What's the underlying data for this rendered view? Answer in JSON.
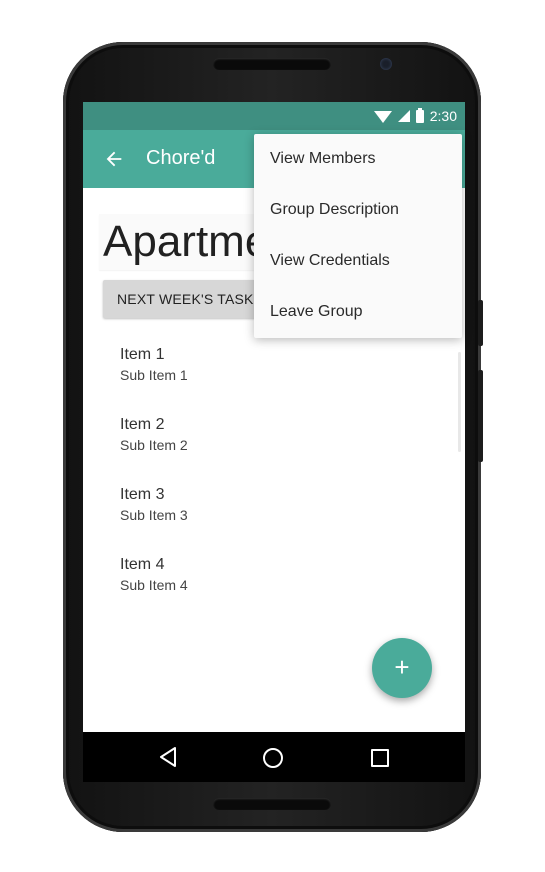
{
  "statusbar": {
    "time": "2:30"
  },
  "appbar": {
    "title": "Chore'd"
  },
  "group": {
    "title": "Apartme"
  },
  "tasks_button": {
    "label": "NEXT WEEK'S TASKS"
  },
  "list": {
    "items": [
      {
        "title": "Item 1",
        "subtitle": "Sub Item 1"
      },
      {
        "title": "Item 2",
        "subtitle": "Sub Item 2"
      },
      {
        "title": "Item 3",
        "subtitle": "Sub Item 3"
      },
      {
        "title": "Item 4",
        "subtitle": "Sub Item 4"
      }
    ]
  },
  "fab": {
    "label": "+"
  },
  "menu": {
    "items": [
      {
        "label": "View Members"
      },
      {
        "label": "Group Description"
      },
      {
        "label": "View Credentials"
      },
      {
        "label": "Leave Group"
      }
    ]
  },
  "colors": {
    "primary": "#4aab9a",
    "primary_dark": "#3f8f81"
  }
}
